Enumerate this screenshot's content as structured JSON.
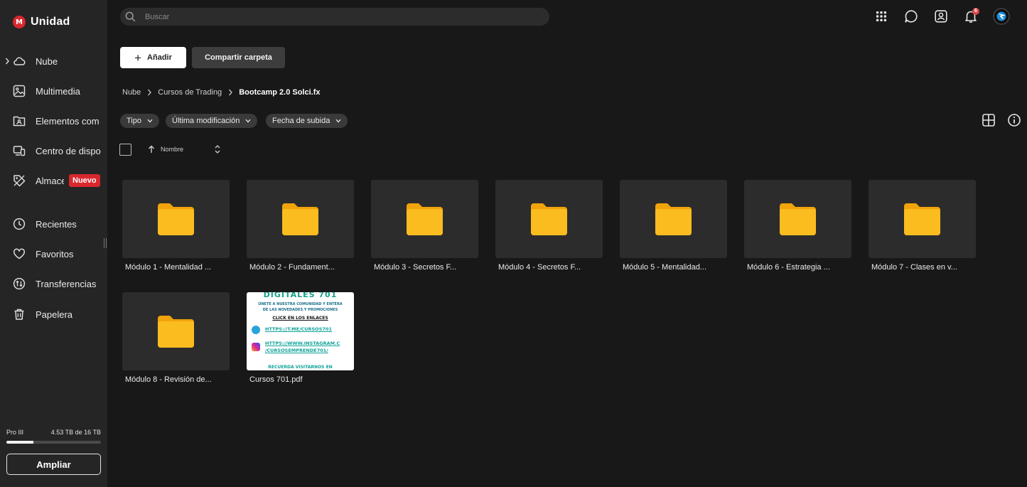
{
  "app": {
    "logo_mark": "M",
    "title": "Unidad"
  },
  "sidebar": {
    "items": [
      {
        "label": "Nube",
        "icon": "cloud-icon"
      },
      {
        "label": "Multimedia",
        "icon": "image-icon"
      },
      {
        "label": "Elementos com",
        "icon": "shared-folder-icon"
      },
      {
        "label": "Centro de dispo",
        "icon": "devices-icon"
      },
      {
        "label": "Almace",
        "icon": "tag-icon",
        "badge": "Nuevo"
      },
      {
        "label": "Recientes",
        "icon": "clock-icon"
      },
      {
        "label": "Favoritos",
        "icon": "heart-icon"
      },
      {
        "label": "Transferencias",
        "icon": "transfer-icon"
      },
      {
        "label": "Papelera",
        "icon": "trash-icon"
      }
    ],
    "storage": {
      "plan": "Pro III",
      "usage": "4.53 TB de 16 TB",
      "used_fraction": 0.283
    },
    "upgrade_label": "Ampliar"
  },
  "header": {
    "search_placeholder": "Buscar",
    "notification_count": "6"
  },
  "actions": {
    "add_label": "Añadir",
    "share_label": "Compartir carpeta"
  },
  "breadcrumb": [
    "Nube",
    "Cursos de Trading",
    "Bootcamp 2.0 Solci.fx"
  ],
  "filters": [
    "Tipo",
    "Última modificación",
    "Fecha de subida"
  ],
  "list_header": {
    "sort_label": "Nombre"
  },
  "items": [
    {
      "name": "Módulo 1 - Mentalidad ...",
      "type": "folder"
    },
    {
      "name": "Módulo 2 - Fundament...",
      "type": "folder"
    },
    {
      "name": "Módulo 3 - Secretos F...",
      "type": "folder"
    },
    {
      "name": "Módulo 4 - Secretos F...",
      "type": "folder"
    },
    {
      "name": "Módulo 5 - Mentalidad...",
      "type": "folder"
    },
    {
      "name": "Módulo 6 - Estrategia ...",
      "type": "folder"
    },
    {
      "name": "Módulo 7 - Clases en v...",
      "type": "folder"
    },
    {
      "name": "Módulo 8 - Revisión de...",
      "type": "folder"
    },
    {
      "name": "Cursos 701.pdf",
      "type": "pdf"
    }
  ],
  "pdf_preview": {
    "heading": "DIGITALES 701",
    "line1": "ÚNETE A NUESTRA COMUNIDAD Y ENTÉRA",
    "line2": "DE LAS NOVEDADES Y PROMOCIONES",
    "click": "CLICK EN LOS ENLACES",
    "link1": "HTTPS://T.ME/CURSOS701",
    "link2": "HTTPS://WWW.INSTAGRAM.C",
    "link3": "/CURSOSEMPRENDE701/",
    "footer": "RECUERDA VISITARNOS EN"
  },
  "colors": {
    "folder": "#f5b014",
    "brand": "#d9272e",
    "sidebar_bg": "#252525",
    "main_bg": "#181818"
  }
}
